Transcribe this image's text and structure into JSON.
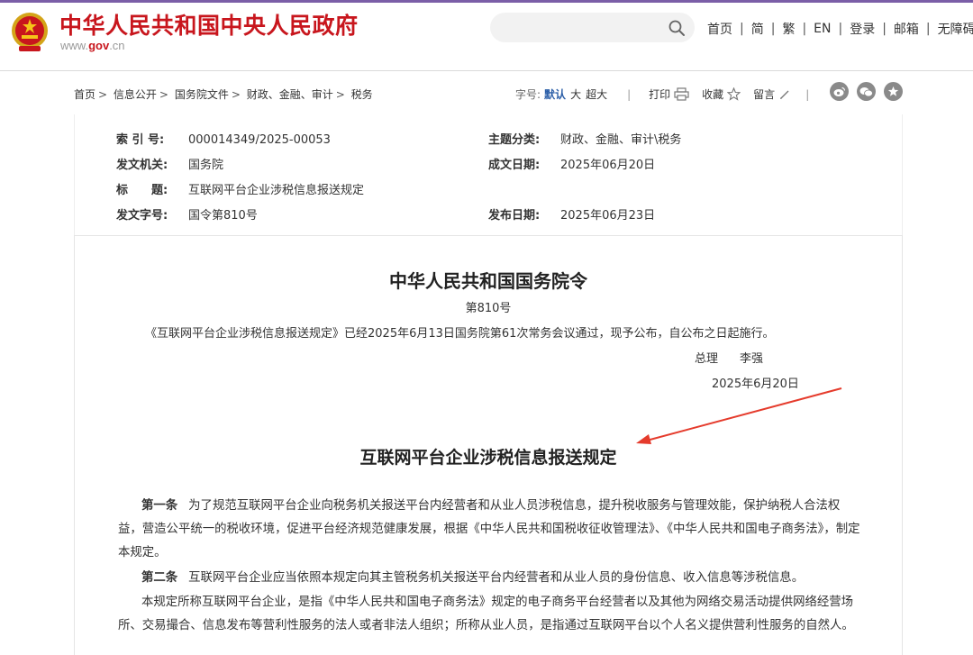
{
  "header": {
    "site_title": "中华人民共和国中央人民政府",
    "domain_prefix": "www.",
    "domain_brand": "gov",
    "domain_suffix": ".cn",
    "search": {
      "placeholder": ""
    },
    "nav": [
      "首页",
      "简",
      "繁",
      "EN",
      "登录",
      "邮箱",
      "无障碍"
    ]
  },
  "breadcrumb": [
    "首页",
    "信息公开",
    "国务院文件",
    "财政、金融、审计",
    "税务"
  ],
  "tools": {
    "font_label": "字号:",
    "size_default": "默认",
    "size_large": "大",
    "size_xlarge": "超大",
    "print": "打印",
    "favorite": "收藏",
    "comment": "留言"
  },
  "social_icons": [
    "weibo-icon",
    "wechat-icon",
    "star-icon"
  ],
  "meta": {
    "index_no_label": "索 引 号:",
    "index_no": "000014349/2025-00053",
    "topic_label": "主题分类:",
    "topic": "财政、金融、审计\\税务",
    "issuer_label": "发文机关:",
    "issuer": "国务院",
    "written_label": "成文日期:",
    "written_date": "2025年06月20日",
    "title_label": "标　　题:",
    "title": "互联网平台企业涉税信息报送规定",
    "doc_no_label": "发文字号:",
    "doc_no": "国令第810号",
    "publish_label": "发布日期:",
    "publish_date": "2025年06月23日"
  },
  "doc": {
    "order_title": "中华人民共和国国务院令",
    "order_no": "第810号",
    "order_text": "《互联网平台企业涉税信息报送规定》已经2025年6月13日国务院第61次常务会议通过，现予公布，自公布之日起施行。",
    "signer_title": "总理",
    "signer_name": "李强",
    "sign_date": "2025年6月20日",
    "reg_title": "互联网平台企业涉税信息报送规定",
    "articles": [
      {
        "num": "第一条",
        "text": "为了规范互联网平台企业向税务机关报送平台内经营者和从业人员涉税信息，提升税收服务与管理效能，保护纳税人合法权益，营造公平统一的税收环境，促进平台经济规范健康发展，根据《中华人民共和国税收征收管理法》、《中华人民共和国电子商务法》，制定本规定。"
      },
      {
        "num": "第二条",
        "text": "互联网平台企业应当依照本规定向其主管税务机关报送平台内经营者和从业人员的身份信息、收入信息等涉税信息。"
      },
      {
        "num": "",
        "text": "本规定所称互联网平台企业，是指《中华人民共和国电子商务法》规定的电子商务平台经营者以及其他为网络交易活动提供网络经营场所、交易撮合、信息发布等营利性服务的法人或者非法人组织；所称从业人员，是指通过互联网平台以个人名义提供营利性服务的自然人。"
      }
    ]
  },
  "colors": {
    "brand_red": "#c8161d",
    "accent_purple": "#7b5ea7",
    "arrow_red": "#e53b2c",
    "link_blue": "#2c5fa8"
  }
}
